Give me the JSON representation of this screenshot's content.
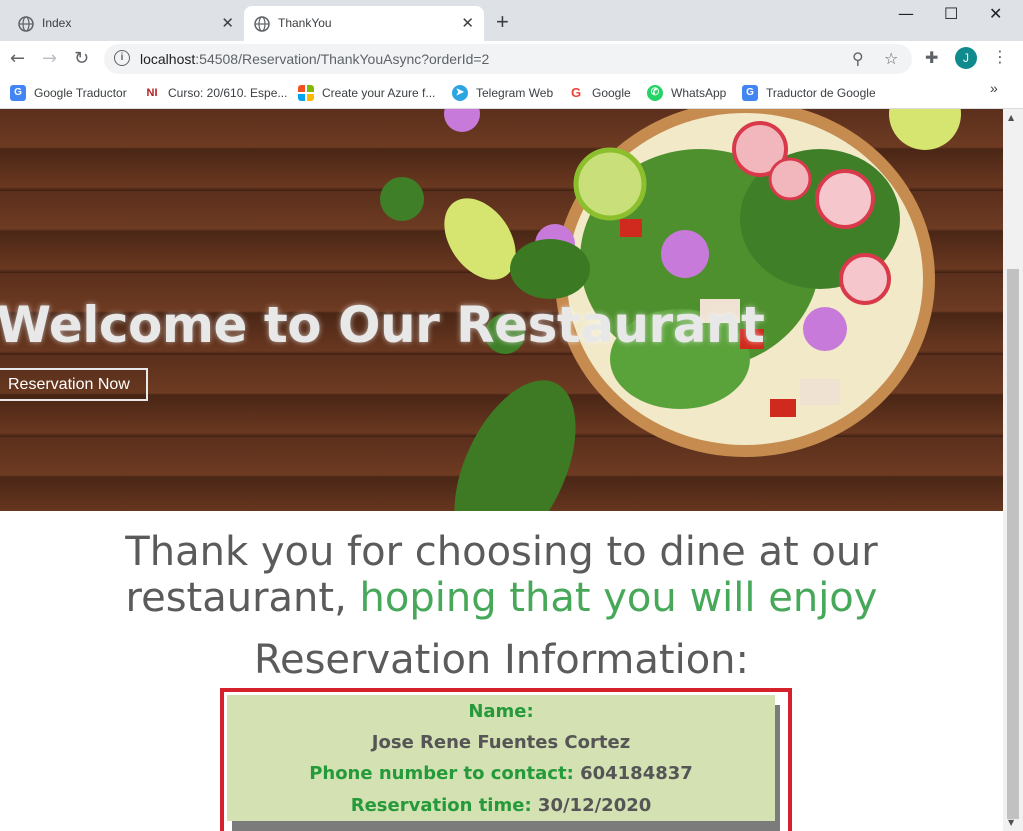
{
  "browser": {
    "tabs": [
      {
        "title": "Index",
        "active": false
      },
      {
        "title": "ThankYou",
        "active": true
      }
    ],
    "url": {
      "host": "localhost",
      "port_path": ":54508/Reservation/ThankYouAsync?orderId=2"
    },
    "profile_initial": "J",
    "bookmarks": [
      {
        "label": "Google Traductor",
        "icon": "google-translate-icon",
        "color": "#4285f4",
        "glyph": "G"
      },
      {
        "label": "Curso: 20/610. Espe...",
        "icon": "ni-icon",
        "color": "#b71c1c",
        "glyph": "NI"
      },
      {
        "label": "Create your Azure f...",
        "icon": "microsoft-icon",
        "color": "#f25022",
        "glyph": ""
      },
      {
        "label": "Telegram Web",
        "icon": "telegram-icon",
        "color": "#2ca5e0",
        "glyph": "➤"
      },
      {
        "label": "Google",
        "icon": "google-icon",
        "color": "#ea4335",
        "glyph": "G"
      },
      {
        "label": "WhatsApp",
        "icon": "whatsapp-icon",
        "color": "#25d366",
        "glyph": "✆"
      },
      {
        "label": "Traductor de Google",
        "icon": "google-translate-icon",
        "color": "#4285f4",
        "glyph": "G"
      }
    ]
  },
  "hero": {
    "title": "Welcome to Our Restaurant",
    "button": "Reservation Now"
  },
  "thanks": {
    "line1": "Thank you for choosing to dine at our",
    "line2_plain": "restaurant, ",
    "line2_highlight": "hoping that you will enjoy"
  },
  "reservation": {
    "heading": "Reservation Information:",
    "name_label": "Name:",
    "name_value": "Jose Rene Fuentes Cortez",
    "phone_label": "Phone number to contact:",
    "phone_value": "604184837",
    "time_label": "Reservation time:",
    "time_value": "30/12/2020"
  },
  "colors": {
    "accent_green": "#47a85a",
    "label_green": "#259a3a",
    "frame_red": "#d5212b",
    "card_bg": "#d3e1b3"
  }
}
